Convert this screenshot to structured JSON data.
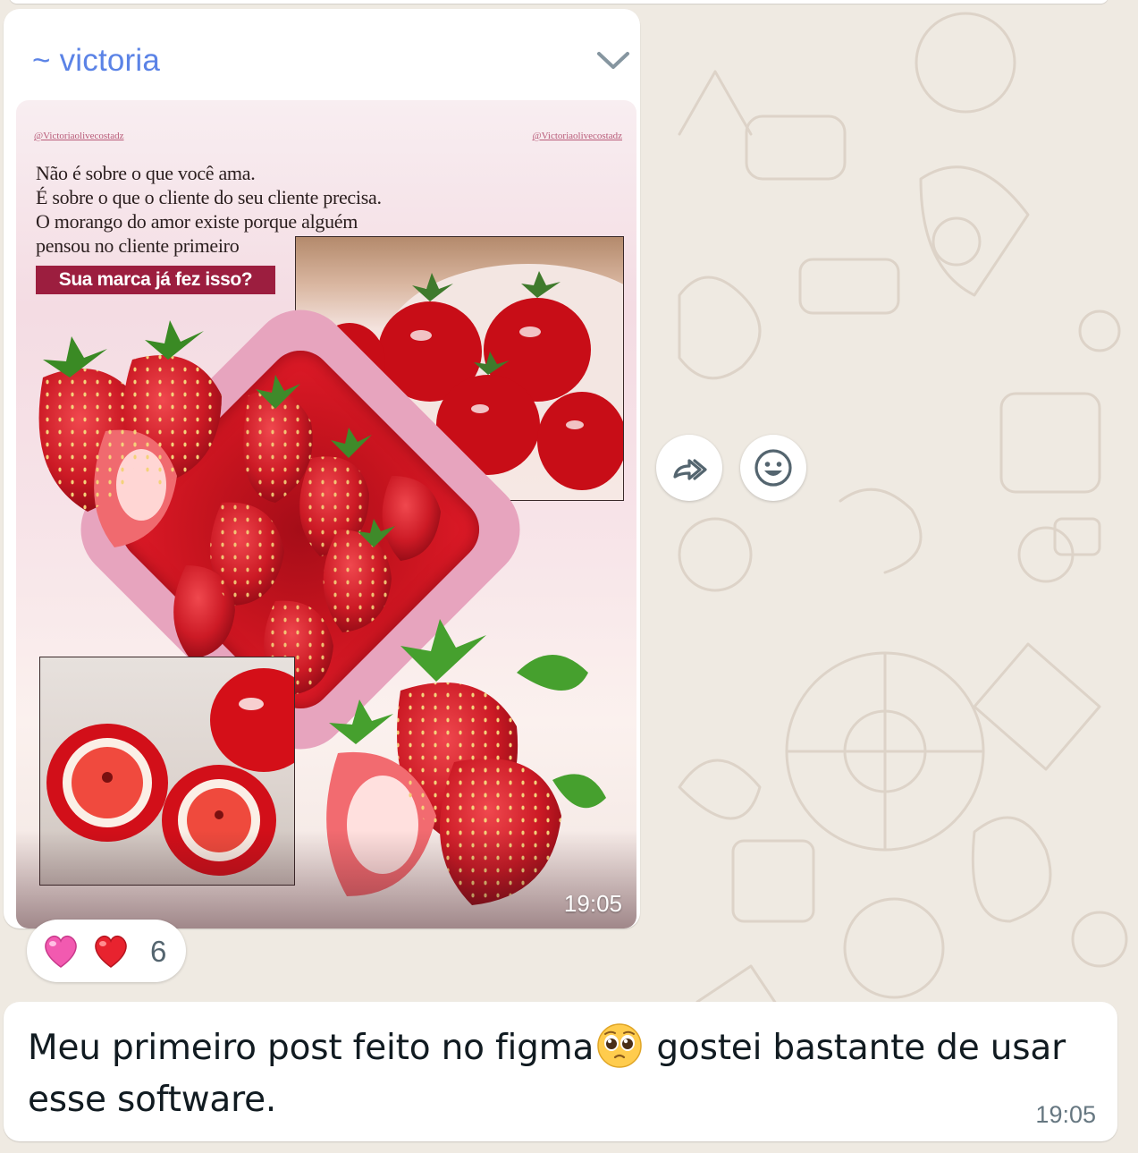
{
  "message_image": {
    "sender": "~ victoria",
    "time": "19:05",
    "post": {
      "handle_left": "@Victoriaolivecostadz",
      "handle_right": "@Victoriaolivecostadz",
      "lines": [
        "Não é sobre o que você ama.",
        "É sobre o que o cliente do seu cliente precisa.",
        "O morango do amor existe porque alguém",
        "pensou no cliente primeiro"
      ],
      "cta": "Sua marca já fez isso?"
    }
  },
  "reactions": {
    "emojis": [
      "pink-heart-icon",
      "red-heart-icon"
    ],
    "count": "6"
  },
  "actions": {
    "forward_icon": "forward-icon",
    "react_icon": "smiley-icon"
  },
  "message_text": {
    "before_emoji": "Meu primeiro post feito no figma",
    "emoji": "pleading-face-icon",
    "after_emoji": " gostei bastante de usar esse software.",
    "time": "19:05"
  },
  "colors": {
    "wallpaper": "#efeae2",
    "sender_name": "#5b83e6",
    "cta_background": "#9c1e3f",
    "meta_text": "#667781"
  }
}
